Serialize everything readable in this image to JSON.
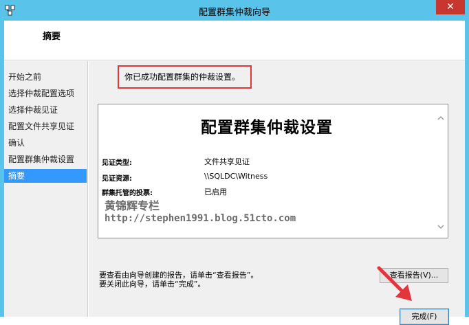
{
  "window": {
    "title": "配置群集仲裁向导",
    "close_glyph": "✕"
  },
  "header": {
    "title": "摘要"
  },
  "sidebar": {
    "items": [
      {
        "label": "开始之前"
      },
      {
        "label": "选择仲裁配置选项"
      },
      {
        "label": "选择仲裁见证"
      },
      {
        "label": "配置文件共享见证"
      },
      {
        "label": "确认"
      },
      {
        "label": "配置群集仲裁设置"
      },
      {
        "label": "摘要",
        "active": true
      }
    ]
  },
  "main": {
    "success_message": "你已成功配置群集的仲裁设置。",
    "report": {
      "title": "配置群集仲裁设置",
      "rows": [
        {
          "key": "见证类型:",
          "value": "文件共享见证"
        },
        {
          "key": "见证资源:",
          "value": "\\\\SQLDC\\Witness"
        },
        {
          "key": "群集托管的投票:",
          "value": "已启用"
        }
      ],
      "watermark_line1": "黄锦辉专栏",
      "watermark_line2": "http://stephen1991.blog.51cto.com"
    },
    "hint_view_report": "要查看由向导创建的报告，请单击“查看报告”。",
    "hint_close": "要关闭此向导，请单击“完成”。",
    "view_report_button": "查看报告(V)...",
    "finish_button": "完成(F)"
  },
  "colors": {
    "titlebar": "#5ac3ea",
    "selection": "#3399ff",
    "highlight_box": "#e2363c",
    "close": "#c7372f"
  }
}
